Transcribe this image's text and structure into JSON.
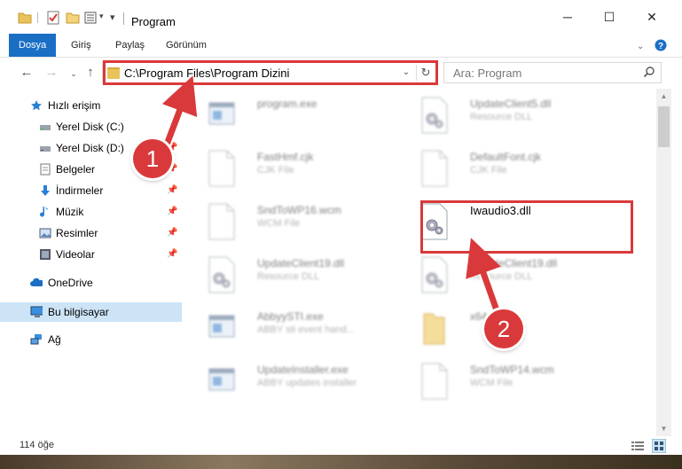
{
  "window": {
    "title": "Program",
    "controls": {
      "minimize": "─",
      "maximize": "☐",
      "close": "✕"
    }
  },
  "ribbon": {
    "tabs": [
      {
        "label": "Dosya",
        "active": true
      },
      {
        "label": "Giriş"
      },
      {
        "label": "Paylaş"
      },
      {
        "label": "Görünüm"
      }
    ]
  },
  "address_bar": {
    "path": "C:\\Program Files\\Program Dizini",
    "search_placeholder": "Ara: Program"
  },
  "nav_pane": {
    "quick_access": "Hızlı erişim",
    "items": [
      {
        "label": "Yerel Disk (C:)",
        "icon": "drive-icon"
      },
      {
        "label": "Yerel Disk (D:)",
        "icon": "drive-icon"
      },
      {
        "label": "Belgeler",
        "icon": "documents-icon"
      },
      {
        "label": "İndirmeler",
        "icon": "downloads-icon"
      },
      {
        "label": "Müzik",
        "icon": "music-icon"
      },
      {
        "label": "Resimler",
        "icon": "pictures-icon"
      },
      {
        "label": "Videolar",
        "icon": "videos-icon"
      }
    ],
    "onedrive": "OneDrive",
    "this_pc": "Bu bilgisayar",
    "network": "Ağ"
  },
  "files": [
    {
      "name": "program.exe",
      "type": "",
      "icon": "exe-icon",
      "blurred": true
    },
    {
      "name": "UpdateClient5.dll",
      "type": "Resource DLL",
      "icon": "dll-icon",
      "blurred": true
    },
    {
      "name": "FastHmf.cjk",
      "type": "CJK File",
      "icon": "file-icon",
      "blurred": true
    },
    {
      "name": "DefaultFont.cjk",
      "type": "CJK File",
      "icon": "file-icon",
      "blurred": true
    },
    {
      "name": "SndToWP16.wcm",
      "type": "WCM File",
      "icon": "file-icon",
      "blurred": true
    },
    {
      "name": "Iwaudio3.dll",
      "type": "",
      "icon": "dll-icon",
      "blurred": false
    },
    {
      "name": "UpdateClient19.dll",
      "type": "Resource DLL",
      "icon": "dll-icon",
      "blurred": true
    },
    {
      "name": "UpdateClient19.dll",
      "type": "Resource DLL",
      "icon": "dll-icon",
      "blurred": true
    },
    {
      "name": "AbbyySTI.exe",
      "type": "ABBY sti event hand...",
      "icon": "exe-icon",
      "blurred": true
    },
    {
      "name": "x64",
      "type": "",
      "icon": "folder-icon",
      "blurred": true
    },
    {
      "name": "UpdateInstaller.exe",
      "type": "ABBY updates installer",
      "icon": "exe-icon",
      "blurred": true
    },
    {
      "name": "SndToWP14.wcm",
      "type": "WCM File",
      "icon": "file-icon",
      "blurred": true
    }
  ],
  "status": {
    "item_count": "114 öğe"
  },
  "annotations": [
    {
      "label": "1"
    },
    {
      "label": "2"
    }
  ],
  "colors": {
    "accent": "#1a6fc4",
    "highlight": "#d9393b",
    "selection": "#cde4f7"
  }
}
